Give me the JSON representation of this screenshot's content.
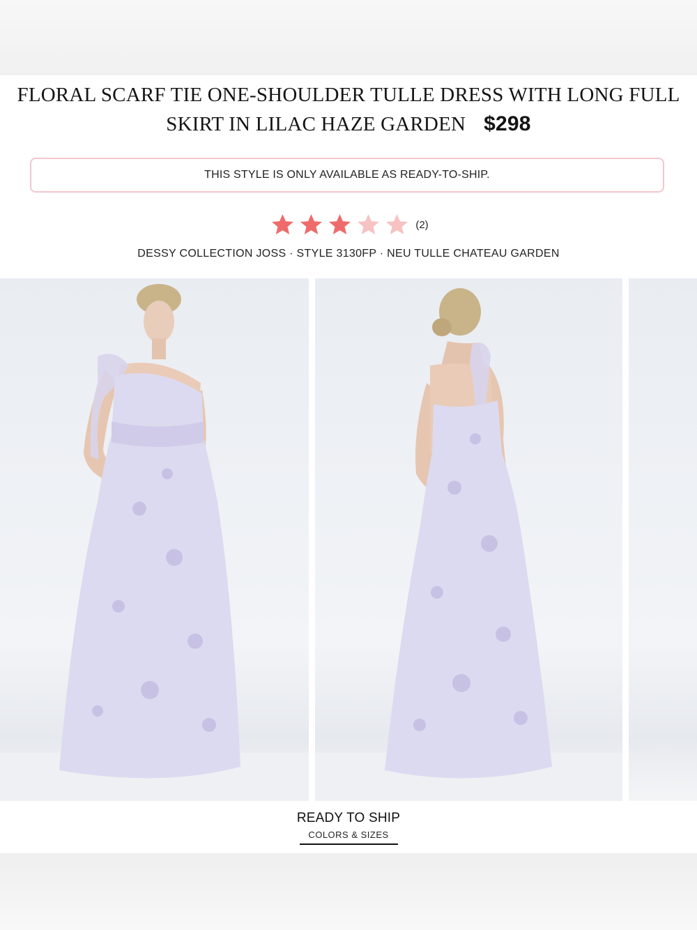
{
  "product": {
    "title": "FLORAL SCARF TIE ONE-SHOULDER TULLE DRESS WITH LONG FULL SKIRT IN LILAC HAZE GARDEN",
    "price": "$298"
  },
  "notice": "THIS STYLE IS ONLY AVAILABLE AS READY-TO-SHIP.",
  "rating": {
    "stars": 3,
    "max": 5,
    "count": "(2)"
  },
  "meta_line": "DESSY COLLECTION JOSS · STYLE 3130FP · NEU TULLE CHATEAU GARDEN",
  "gallery": {
    "images": [
      {
        "name": "front view"
      },
      {
        "name": "back view"
      },
      {
        "name": "partial third image"
      }
    ]
  },
  "tabs": {
    "main": "READY TO SHIP",
    "sub": "COLORS & SIZES"
  },
  "colors": {
    "star_filled": "#ef6b6b",
    "star_empty": "#f6c2c2",
    "notice_border": "#f2c6cf",
    "dress": "#dcdaf0"
  }
}
